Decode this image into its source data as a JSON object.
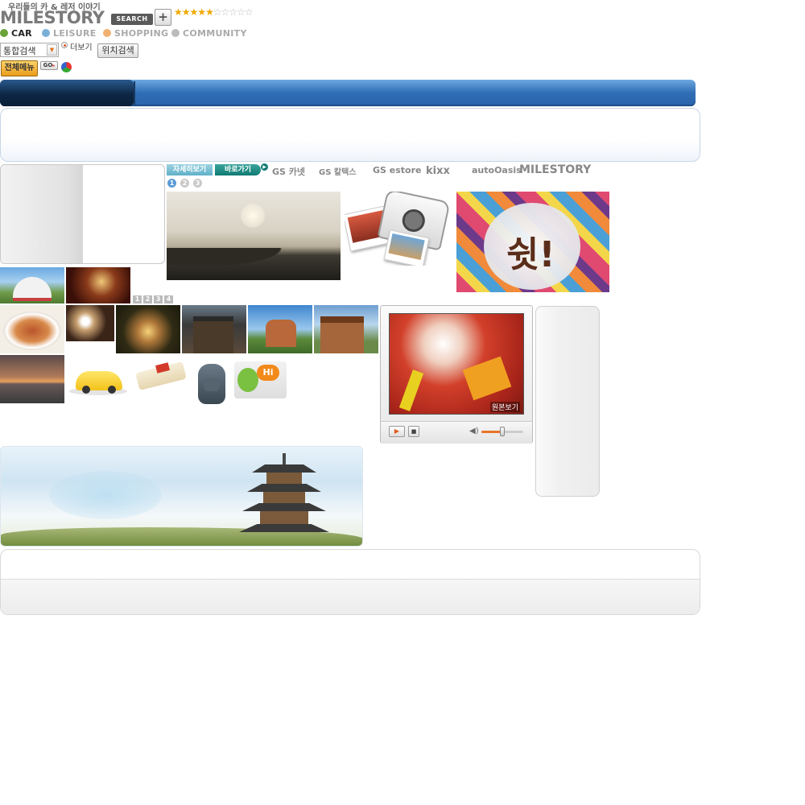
{
  "header": {
    "tagline": "우리들의 카 & 레저 이야기",
    "logo_text": "MILESTORY",
    "search_button": "SEARCH",
    "plus_button": "+",
    "rating_filled": 5,
    "rating_total": 10
  },
  "nav": [
    {
      "label": "CAR",
      "color": "#222222",
      "dot": "#6aa338"
    },
    {
      "label": "LEISURE",
      "color": "#aaaaaa",
      "dot": "#7ab0d8"
    },
    {
      "label": "SHOPPING",
      "color": "#aaaaaa",
      "dot": "#f0b070"
    },
    {
      "label": "COMMUNITY",
      "color": "#aaaaaa",
      "dot": "#bbbbbb"
    }
  ],
  "search": {
    "select_value": "통합검색",
    "more_label": "더보기",
    "location_search": "위치검색"
  },
  "quick": {
    "all_menu": "전체메뉴",
    "go_label": "GO"
  },
  "promo": {
    "detail_button": "자세히보기",
    "shortcut_button": "바로가기",
    "pages": [
      "1",
      "2",
      "3"
    ],
    "shout_text": "쉿!"
  },
  "brands": [
    {
      "label": "GS 카넷"
    },
    {
      "label": "GS 칼텍스"
    },
    {
      "label": "GS estore"
    },
    {
      "label": "kixx"
    },
    {
      "label": "autoOasis"
    },
    {
      "label": "MILESTORY"
    }
  ],
  "small_pager": [
    "1",
    "2",
    "3",
    "4"
  ],
  "video": {
    "original_view": "원본보기",
    "volume": 0.5
  },
  "colors": {
    "accent_blue": "#3d7fc9",
    "dark_blue": "#13345c",
    "teal": "#178079"
  }
}
